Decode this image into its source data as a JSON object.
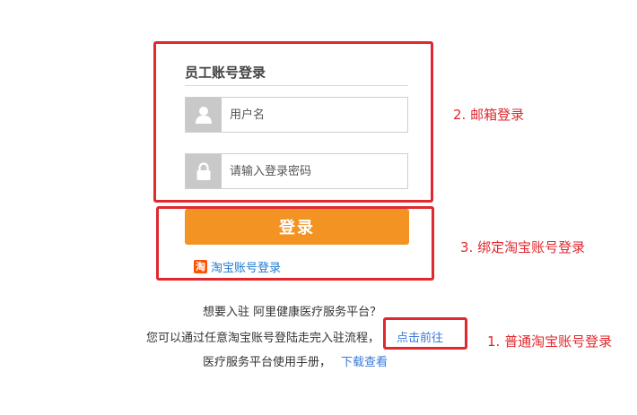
{
  "form": {
    "title": "员工账号登录",
    "username_placeholder": "用户名",
    "password_placeholder": "请输入登录密码",
    "login_label": "登录",
    "taobao_icon_char": "淘",
    "taobao_label": "淘宝账号登录"
  },
  "info": {
    "line1": "想要入驻 阿里健康医疗服务平台？",
    "line2": "您可以通过任意淘宝账号登陆走完入驻流程，",
    "line2_link": "点击前往",
    "line3": "医疗服务平台使用手册，",
    "line3_link": "下载查看"
  },
  "annotations": {
    "email_login": "2. 邮箱登录",
    "bind_taobao": "3. 绑定淘宝账号登录",
    "normal_taobao": "1. 普通淘宝账号登录"
  },
  "colors": {
    "annotation_red": "#e0282e",
    "login_orange": "#f39323",
    "link_blue": "#3b78d8",
    "taobao_orange": "#ff5000"
  },
  "icons": {
    "username": "user-icon",
    "password": "lock-icon",
    "taobao": "taobao-logo-icon"
  }
}
